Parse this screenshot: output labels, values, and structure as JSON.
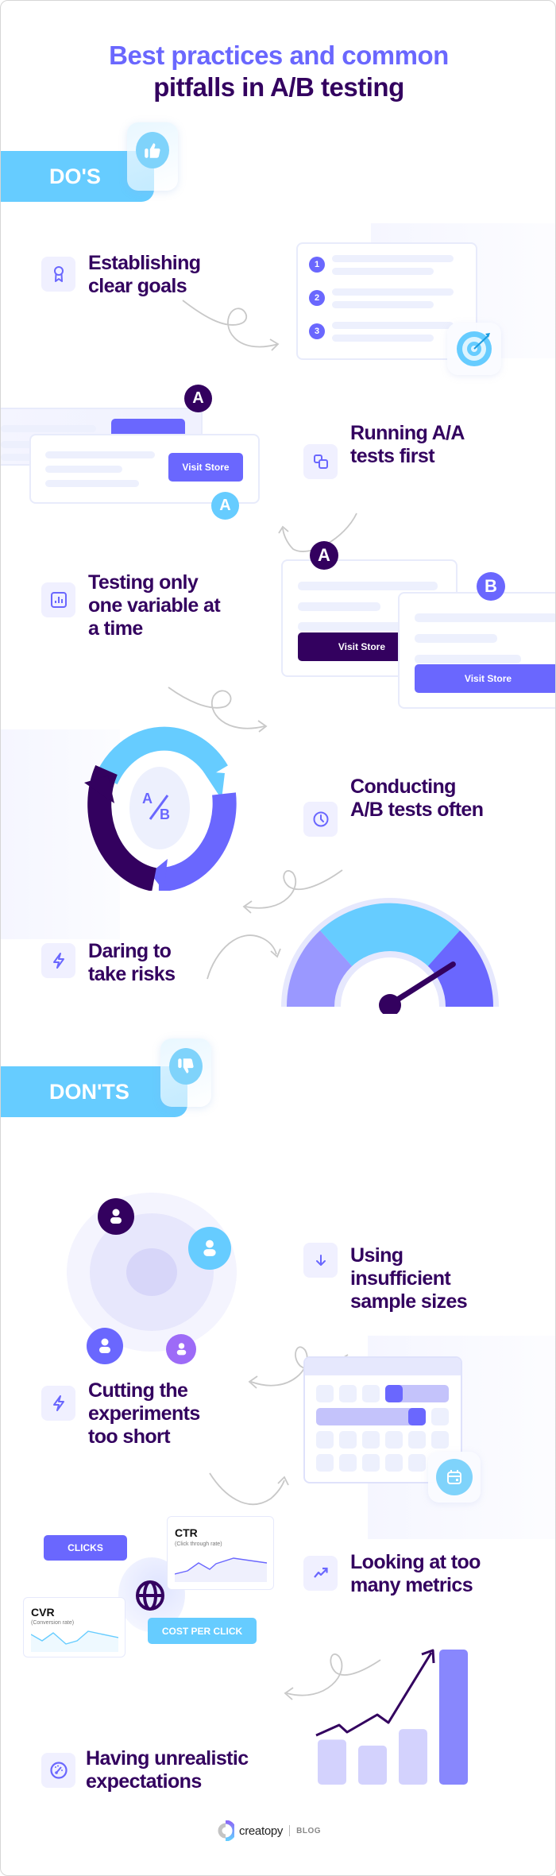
{
  "header": {
    "title_line1": "Best practices and common",
    "title_line2": "pitfalls in A/B testing"
  },
  "dos": {
    "label": "DO'S",
    "icon": "thumbs-up-icon",
    "items": [
      {
        "title": "Establishing clear goals",
        "lines": [
          "Establishing",
          "clear goals"
        ],
        "icon": "award-ribbon-icon",
        "illustration": {
          "numbers": [
            "1",
            "2",
            "3"
          ],
          "badge_icon": "target-icon"
        }
      },
      {
        "title": "Running A/A tests first",
        "lines": [
          "Running A/A",
          "tests first"
        ],
        "icon": "copy-icon",
        "illustration": {
          "badge_back": "A",
          "badge_front": "A",
          "button_label": "Visit Store"
        }
      },
      {
        "title": "Testing only one variable at a time",
        "lines": [
          "Testing only",
          "one variable at",
          "a time"
        ],
        "icon": "bar-chart-icon",
        "illustration": {
          "variant_a": "A",
          "variant_b": "B",
          "button_a_label": "Visit Store",
          "button_b_label": "Visit Store"
        }
      },
      {
        "title": "Conducting A/B tests often",
        "lines": [
          "Conducting",
          "A/B tests often"
        ],
        "icon": "clock-icon",
        "illustration": {
          "center_label_top": "A",
          "center_label_bottom": "B"
        }
      },
      {
        "title": "Daring to take risks",
        "lines": [
          "Daring to",
          "take risks"
        ],
        "icon": "lightning-icon",
        "illustration": {
          "gauge_level": 0.82
        }
      }
    ]
  },
  "donts": {
    "label": "DON'TS",
    "icon": "thumbs-down-icon",
    "items": [
      {
        "title": "Using insufficient sample sizes",
        "lines": [
          "Using",
          "insufficient",
          "sample sizes"
        ],
        "icon": "arrow-down-icon"
      },
      {
        "title": "Cutting the experiments too short",
        "lines": [
          "Cutting the",
          "experiments",
          "too short"
        ],
        "icon": "lightning-icon",
        "illustration": {
          "badge_icon": "calendar-icon"
        }
      },
      {
        "title": "Looking at too many metrics",
        "lines": [
          "Looking at too",
          "many metrics"
        ],
        "icon": "trending-up-icon",
        "illustration": {
          "clicks_label": "CLICKS",
          "cost_label": "COST PER CLICK",
          "ctr_title": "CTR",
          "ctr_sub": "(Click through rate)",
          "cvr_title": "CVR",
          "cvr_sub": "(Conversion rate)"
        }
      },
      {
        "title": "Having unrealistic expectations",
        "lines": [
          "Having unrealistic",
          "expectations"
        ],
        "icon": "speedometer-icon",
        "illustration": {
          "bar_values": [
            3,
            2.6,
            3.7,
            9
          ]
        }
      }
    ]
  },
  "footer": {
    "brand": "creatopy",
    "section": "BLOG"
  },
  "colors": {
    "primary": "#6a67fe",
    "dark": "#33015f",
    "sky": "#66ccff",
    "lavender": "#9a98ff",
    "light": "#edf0fd"
  }
}
